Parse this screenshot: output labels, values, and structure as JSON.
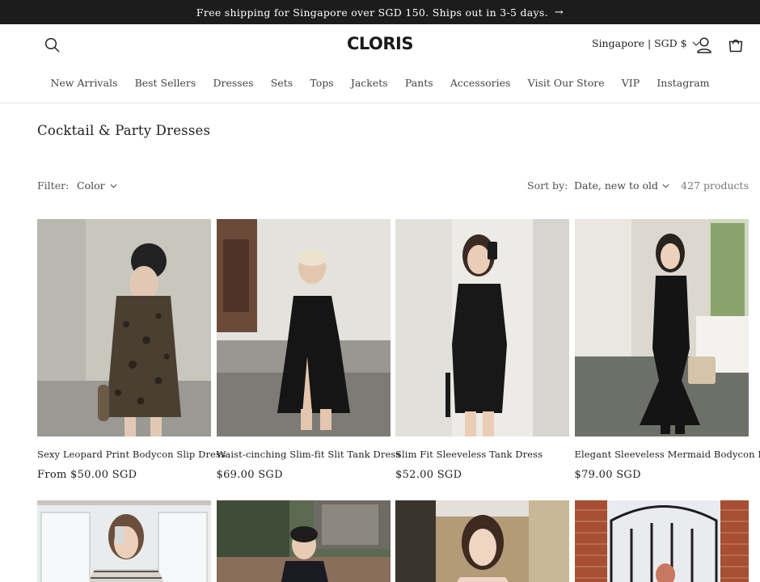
{
  "announcement": {
    "text": "Free shipping for Singapore over SGD 150. Ships out in 3-5 days.",
    "arrow": "→"
  },
  "header": {
    "logo": "CLORIS",
    "locale": "Singapore | SGD $",
    "icons": {
      "search": "search-icon",
      "account": "account-icon",
      "cart": "cart-icon"
    }
  },
  "nav": [
    "New Arrivals",
    "Best Sellers",
    "Dresses",
    "Sets",
    "Tops",
    "Jackets",
    "Pants",
    "Accessories",
    "Visit Our Store",
    "VIP",
    "Instagram"
  ],
  "collection": {
    "title": "Cocktail & Party Dresses"
  },
  "filters": {
    "filter_label": "Filter:",
    "color_label": "Color",
    "sort_label": "Sort by:",
    "sort_value": "Date, new to old",
    "product_count": "427 products"
  },
  "products": [
    {
      "name": "Sexy Leopard Print Bodycon Slip Dress",
      "price": "From $50.00 SGD"
    },
    {
      "name": "Waist-cinching Slim-fit Slit Tank Dress",
      "price": "$69.00 SGD"
    },
    {
      "name": "Slim Fit Sleeveless Tank Dress",
      "price": "$52.00 SGD"
    },
    {
      "name": "Elegant Sleeveless Mermaid Bodycon Dress",
      "price": "$79.00 SGD"
    }
  ],
  "colors": {
    "announce_bg": "#1c1c1c",
    "text": "#1f1f1f",
    "border": "#e6e6e6"
  }
}
